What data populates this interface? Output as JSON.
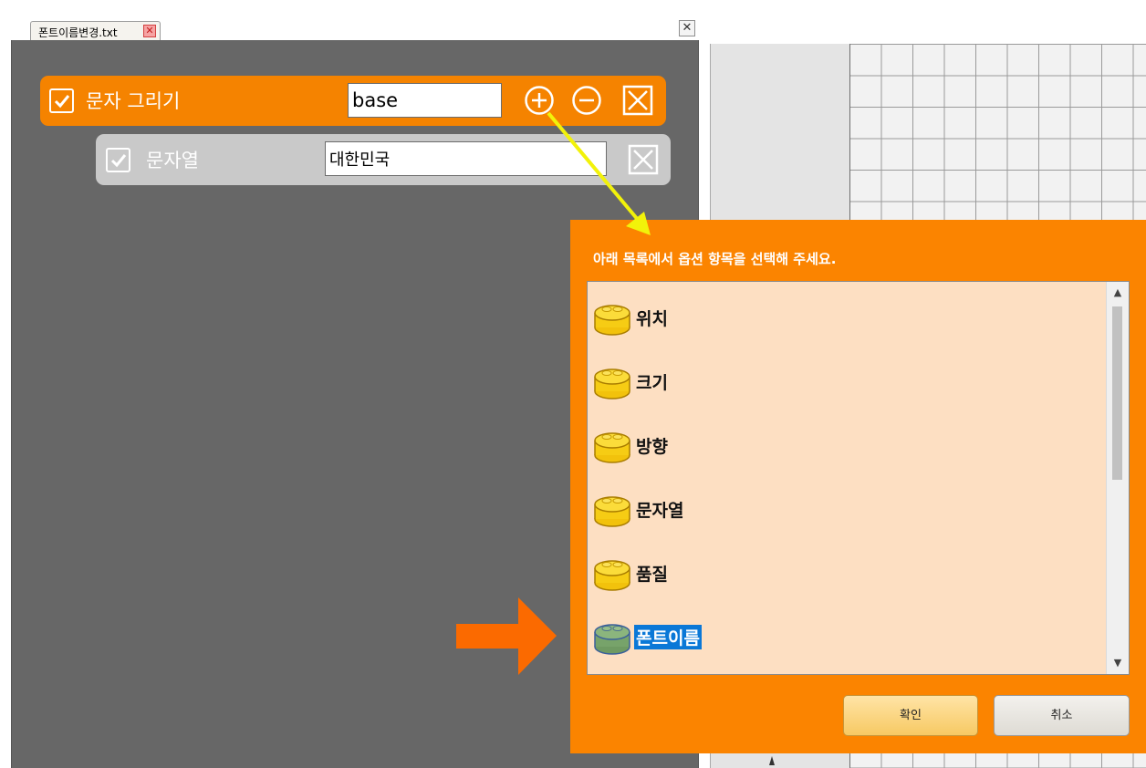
{
  "tab": {
    "label": "폰트이름변경.txt",
    "close_glyph": "✕"
  },
  "panel": {
    "close_glyph": "✕"
  },
  "blocks": {
    "main": {
      "label": "문자 그리기",
      "checked": true,
      "input_value": "base",
      "add_icon": "plus-circle-icon",
      "remove_icon": "minus-circle-icon",
      "delete_icon": "close-box-icon"
    },
    "sub": {
      "label": "문자열",
      "checked": true,
      "input_value": "대한민국",
      "delete_icon": "close-box-icon"
    }
  },
  "dialog": {
    "prompt": "아래 목록에서 옵션 항목을 선택해 주세요.",
    "items": [
      {
        "label": "위치",
        "icon": "yellow-block-icon",
        "selected": false
      },
      {
        "label": "크기",
        "icon": "yellow-block-icon",
        "selected": false
      },
      {
        "label": "방향",
        "icon": "yellow-block-icon",
        "selected": false
      },
      {
        "label": "문자열",
        "icon": "yellow-block-icon",
        "selected": false
      },
      {
        "label": "품질",
        "icon": "yellow-block-icon",
        "selected": false
      },
      {
        "label": "폰트이름",
        "icon": "green-block-icon",
        "selected": true
      }
    ],
    "ok_label": "확인",
    "cancel_label": "취소"
  },
  "colors": {
    "accent": "#fb8400",
    "block_main": "#f58300",
    "block_sub": "#c9c9c9",
    "editor_bg": "#676767",
    "selection": "#0a78d7",
    "list_bg": "#fddfc2"
  }
}
